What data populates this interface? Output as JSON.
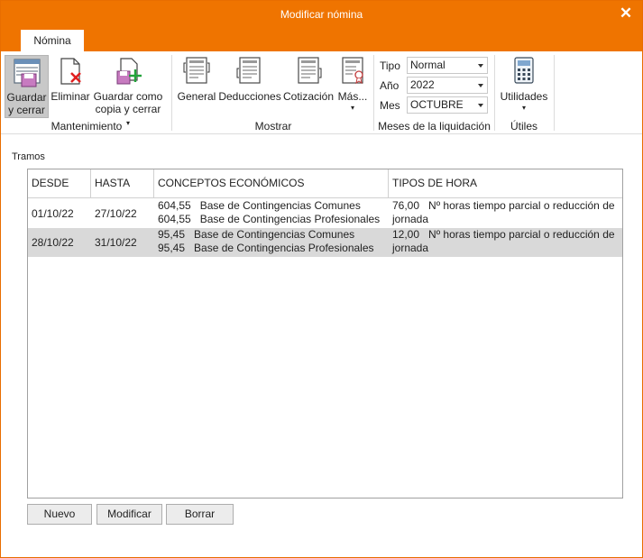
{
  "window": {
    "title": "Modificar nómina",
    "close_icon": "close-icon"
  },
  "tabs": [
    {
      "label": "Nómina"
    }
  ],
  "ribbon": {
    "mantenimiento": {
      "label": "Mantenimiento",
      "guardar": {
        "line1": "Guardar",
        "line2": "y cerrar",
        "icon": "save-close-icon"
      },
      "eliminar": {
        "label": "Eliminar",
        "icon": "delete-document-icon"
      },
      "guardar_copia": {
        "line1": "Guardar como",
        "line2": "copia y cerrar",
        "icon": "save-copy-icon"
      }
    },
    "mostrar": {
      "label": "Mostrar",
      "general": {
        "label": "General",
        "icon": "payslip-general-icon"
      },
      "deducciones": {
        "label": "Deducciones",
        "icon": "payslip-deducciones-icon"
      },
      "cotizacion": {
        "label": "Cotización",
        "icon": "payslip-cotizacion-icon"
      },
      "mas": {
        "label": "Más...",
        "icon": "payslip-more-icon"
      }
    },
    "meses": {
      "label": "Meses de la liquidación",
      "tipo_label": "Tipo",
      "tipo_value": "Normal",
      "anio_label": "Año",
      "anio_value": "2022",
      "mes_label": "Mes",
      "mes_value": "OCTUBRE"
    },
    "utiles": {
      "label": "Útiles",
      "utilidades": {
        "label": "Utilidades",
        "icon": "calculator-icon"
      }
    }
  },
  "tramos": {
    "label": "Tramos",
    "columns": [
      "DESDE",
      "HASTA",
      "CONCEPTOS ECONÓMICOS",
      "TIPOS DE HORA"
    ],
    "rows": [
      {
        "desde": "01/10/22",
        "hasta": "27/10/22",
        "conceptos": [
          {
            "valor": "604,55",
            "texto": "Base de Contingencias Comunes"
          },
          {
            "valor": "604,55",
            "texto": "Base de Contingencias Profesionales"
          }
        ],
        "tipo_hora": {
          "valor": "76,00",
          "linea1": "Nº horas tiempo parcial o reducción de",
          "linea2": "jornada"
        },
        "selected": false
      },
      {
        "desde": "28/10/22",
        "hasta": "31/10/22",
        "conceptos": [
          {
            "valor": "95,45",
            "texto": "Base de Contingencias Comunes"
          },
          {
            "valor": "95,45",
            "texto": "Base de Contingencias Profesionales"
          }
        ],
        "tipo_hora": {
          "valor": "12,00",
          "linea1": "Nº horas tiempo parcial o reducción de",
          "linea2": "jornada"
        },
        "selected": true
      }
    ]
  },
  "buttons": {
    "nuevo": "Nuevo",
    "modificar": "Modificar",
    "borrar": "Borrar"
  },
  "colors": {
    "accent": "#ef7400",
    "selected_row": "#d9d9d9"
  }
}
